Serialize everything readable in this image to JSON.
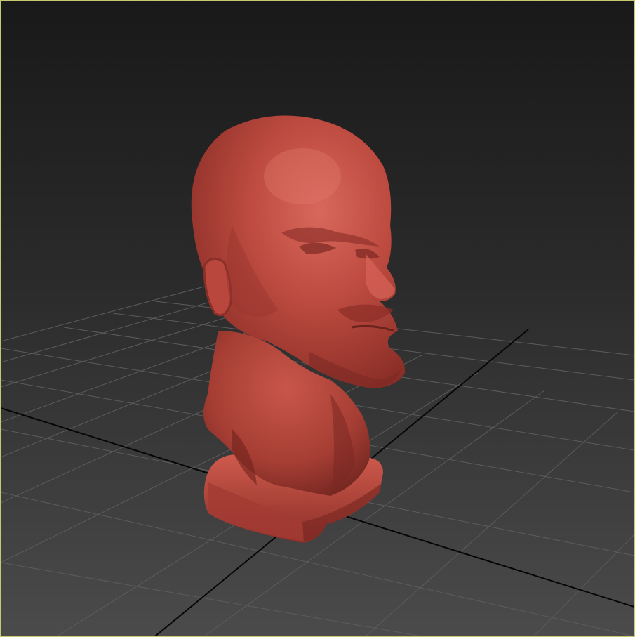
{
  "viewport": {
    "border_color": "#c8c870",
    "background_top": "#191919",
    "background_bottom": "#4a4a4a",
    "grid_color": "#5a5a5a",
    "grid_axis_color": "#050505",
    "model_color": "#b5473d",
    "model_shading_dark": "#7a2a24",
    "model_highlight": "#d56559"
  },
  "objects": [
    {
      "kind": "sculpted-bust",
      "material": "clay"
    }
  ]
}
